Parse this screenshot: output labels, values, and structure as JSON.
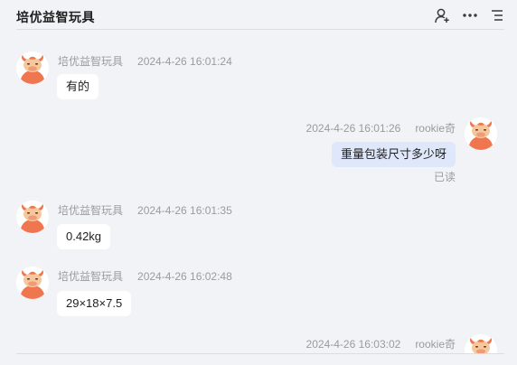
{
  "header": {
    "title": "培优益智玩具"
  },
  "messages": [
    {
      "sender": "培优益智玩具",
      "time": "2024-4-26 16:01:24",
      "text": "有的"
    },
    {
      "sender": "rookie奇",
      "time": "2024-4-26 16:01:26",
      "text": "重量包装尺寸多少呀",
      "status": "已读"
    },
    {
      "sender": "培优益智玩具",
      "time": "2024-4-26 16:01:35",
      "text": "0.42kg"
    },
    {
      "sender": "培优益智玩具",
      "time": "2024-4-26 16:02:48",
      "text": "29×18×7.5"
    },
    {
      "sender": "rookie奇",
      "time": "2024-4-26 16:03:02"
    }
  ],
  "icons": {
    "header": [
      "add-user-icon",
      "more-icon",
      "list-icon"
    ],
    "avatar": "bull-mascot-icon"
  },
  "colors": {
    "background": "#f2f3f6",
    "incoming_bubble": "#ffffff",
    "outgoing_bubble": "#dfe8fb",
    "meta_text": "#9a9ba0"
  }
}
